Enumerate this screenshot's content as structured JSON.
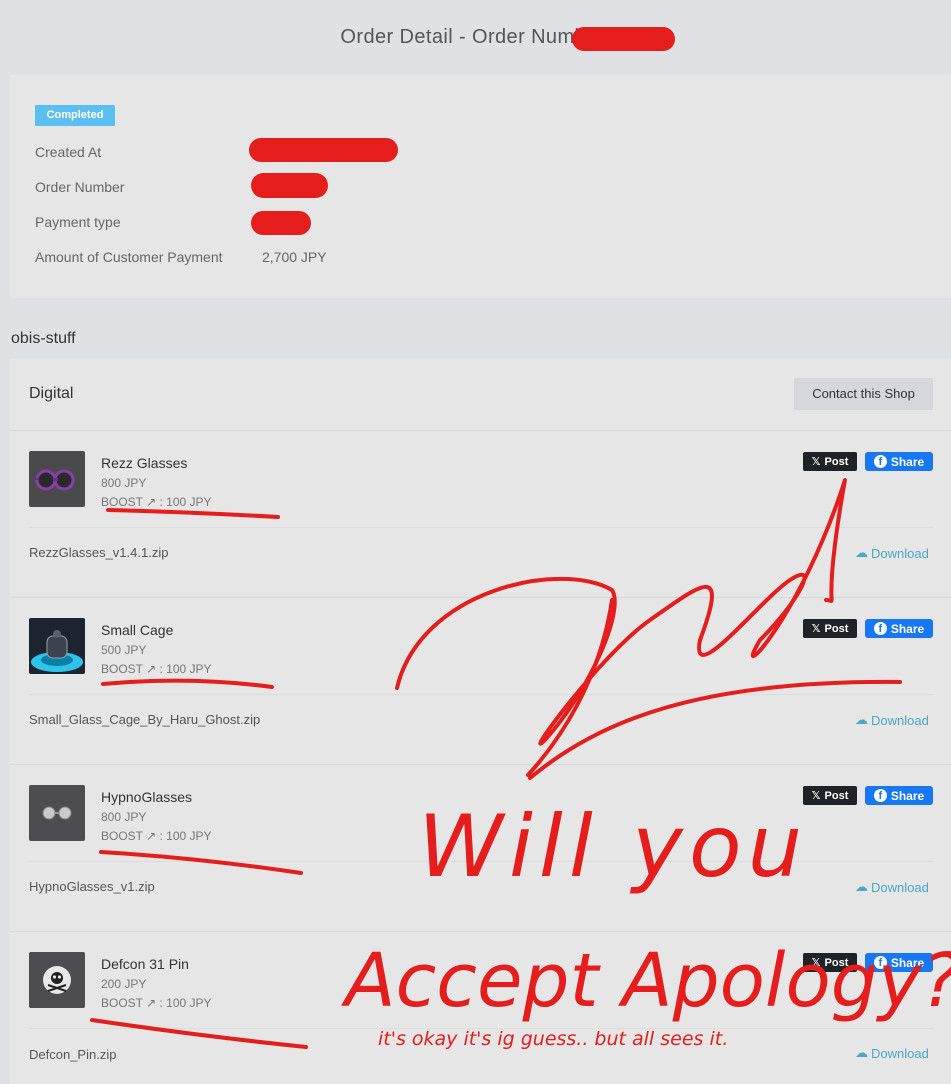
{
  "header": {
    "title": "Order Detail - Order Number:"
  },
  "summary": {
    "status_badge": "Completed",
    "rows": [
      {
        "label": "Created At",
        "value": ""
      },
      {
        "label": "Order Number",
        "value": ""
      },
      {
        "label": "Payment type",
        "value": ""
      },
      {
        "label": "Amount of Customer Payment",
        "value": "2,700 JPY"
      }
    ]
  },
  "shop": {
    "name": "obis-stuff",
    "section_title": "Digital",
    "contact_button": "Contact this Shop",
    "post_label": "Post",
    "share_label": "Share",
    "download_label": "Download",
    "items": [
      {
        "name": "Rezz Glasses",
        "price": "800 JPY",
        "boost": "BOOST ↗ : 100 JPY",
        "file": "RezzGlasses_v1.4.1.zip"
      },
      {
        "name": "Small Cage",
        "price": "500 JPY",
        "boost": "BOOST ↗ : 100 JPY",
        "file": "Small_Glass_Cage_By_Haru_Ghost.zip"
      },
      {
        "name": "HypnoGlasses",
        "price": "800 JPY",
        "boost": "BOOST ↗ : 100 JPY",
        "file": "HypnoGlasses_v1.zip"
      },
      {
        "name": "Defcon 31 Pin",
        "price": "200 JPY",
        "boost": "BOOST ↗ : 100 JPY",
        "file": "Defcon_Pin.zip"
      }
    ]
  },
  "handwriting": {
    "main_line1": "Will you",
    "main_line2": "Accept Apology?",
    "small_note": "it's okay it's ig guess.. but all sees it."
  },
  "colors": {
    "badge": "#5bc0f0",
    "facebook": "#1877f2",
    "x_button": "#1f2328",
    "download": "#4aa8c8",
    "ink": "#e51d1d"
  }
}
